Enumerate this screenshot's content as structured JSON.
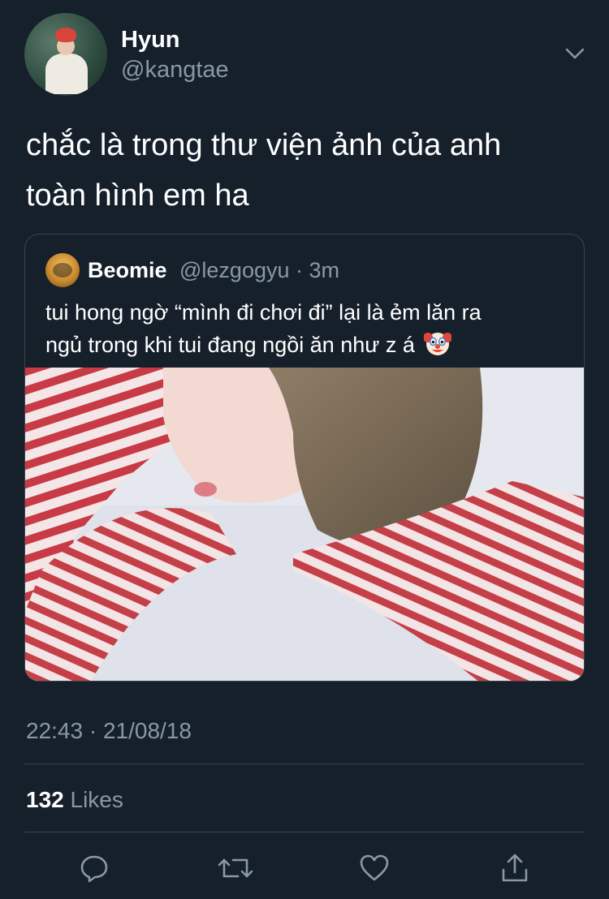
{
  "author": {
    "display_name": "Hyun",
    "handle": "@kangtae"
  },
  "tweet": {
    "text_line1": "chắc là trong thư viện ảnh của anh",
    "text_line2": "toàn hình em ha"
  },
  "quoted_tweet": {
    "display_name": "Beomie",
    "handle": "@lezgogyu",
    "time": "3m",
    "text_line1": "tui hong ngờ “mình đi chơi đi” lại là ẻm lăn ra",
    "text_line2": "ngủ trong khi tui đang ngồi ăn như z á",
    "emoji": "clown-face"
  },
  "meta": {
    "timestamp": "22:43 · 21/08/18",
    "likes_count": "132",
    "likes_label": "Likes"
  },
  "actions": [
    "reply",
    "retweet",
    "like",
    "share"
  ],
  "colors": {
    "background": "#15202b",
    "text": "#ffffff",
    "secondary_text": "#8899a6",
    "border": "#38444d"
  }
}
